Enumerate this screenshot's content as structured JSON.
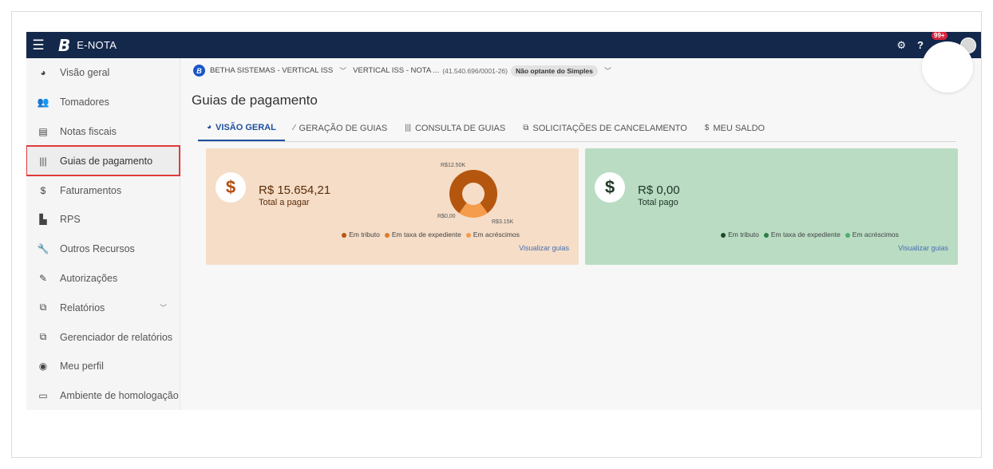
{
  "topbar": {
    "brand_letter": "B",
    "brand_name": "E-NOTA",
    "notification_badge": "99+"
  },
  "sidebar": {
    "items": [
      {
        "label": "Visão geral",
        "icon": "pie-chart-icon"
      },
      {
        "label": "Tomadores",
        "icon": "users-icon"
      },
      {
        "label": "Notas fiscais",
        "icon": "document-icon"
      },
      {
        "label": "Guias de pagamento",
        "icon": "barcode-icon",
        "active": true
      },
      {
        "label": "Faturamentos",
        "icon": "dollar-icon"
      },
      {
        "label": "RPS",
        "icon": "file-icon"
      },
      {
        "label": "Outros Recursos",
        "icon": "wrench-icon"
      },
      {
        "label": "Autorizações",
        "icon": "edit-icon"
      },
      {
        "label": "Relatórios",
        "icon": "copy-icon",
        "has_chevron": true
      },
      {
        "label": "Gerenciador de relatórios",
        "icon": "copy-icon"
      },
      {
        "label": "Meu perfil",
        "icon": "user-circle-icon"
      },
      {
        "label": "Ambiente de homologação",
        "icon": "laptop-icon"
      }
    ]
  },
  "context": {
    "entity": "BETHA SISTEMAS - VERTICAL ISS",
    "company": "VERTICAL ISS - NOTA ...",
    "cnpj": "(41.540.696/0001-26)",
    "regime": "Não optante do Simples"
  },
  "page": {
    "title": "Guias de pagamento"
  },
  "tabs": [
    {
      "label": "VISÃO GERAL",
      "icon": "pie-chart-icon",
      "active": true
    },
    {
      "label": "GERAÇÃO DE GUIAS",
      "icon": "magic-wand-icon"
    },
    {
      "label": "CONSULTA DE GUIAS",
      "icon": "barcode-icon"
    },
    {
      "label": "SOLICITAÇÕES DE CANCELAMENTO",
      "icon": "copy-icon"
    },
    {
      "label": "MEU SALDO",
      "icon": "dollar-icon"
    }
  ],
  "cards": {
    "to_pay": {
      "currency_symbol": "$",
      "amount": "R$ 15.654,21",
      "label": "Total a pagar",
      "legend": [
        "Em tributo",
        "Em taxa de expediente",
        "Em acréscimos"
      ],
      "link": "Visualizar guias",
      "colors": {
        "bg": "#f5ddc8",
        "tributo": "#b5560f",
        "taxa": "#e07b2a",
        "acrescimos": "#f59b4c"
      }
    },
    "paid": {
      "currency_symbol": "$",
      "amount": "R$ 0,00",
      "label": "Total pago",
      "legend": [
        "Em tributo",
        "Em taxa de expediente",
        "Em acréscimos"
      ],
      "link": "Visualizar guias",
      "colors": {
        "bg": "#b9dcc3",
        "tributo": "#1d4a2a",
        "taxa": "#2e7d4a",
        "acrescimos": "#4fae6e"
      }
    }
  },
  "chart_data": {
    "type": "pie",
    "categories": [
      "Em tributo",
      "Em taxa de expediente",
      "Em acréscimos"
    ],
    "values": [
      12500,
      0,
      3150
    ],
    "data_labels": [
      "R$12.50K",
      "R$0,00",
      "R$3.15K"
    ],
    "title": "",
    "legend_position": "bottom"
  }
}
